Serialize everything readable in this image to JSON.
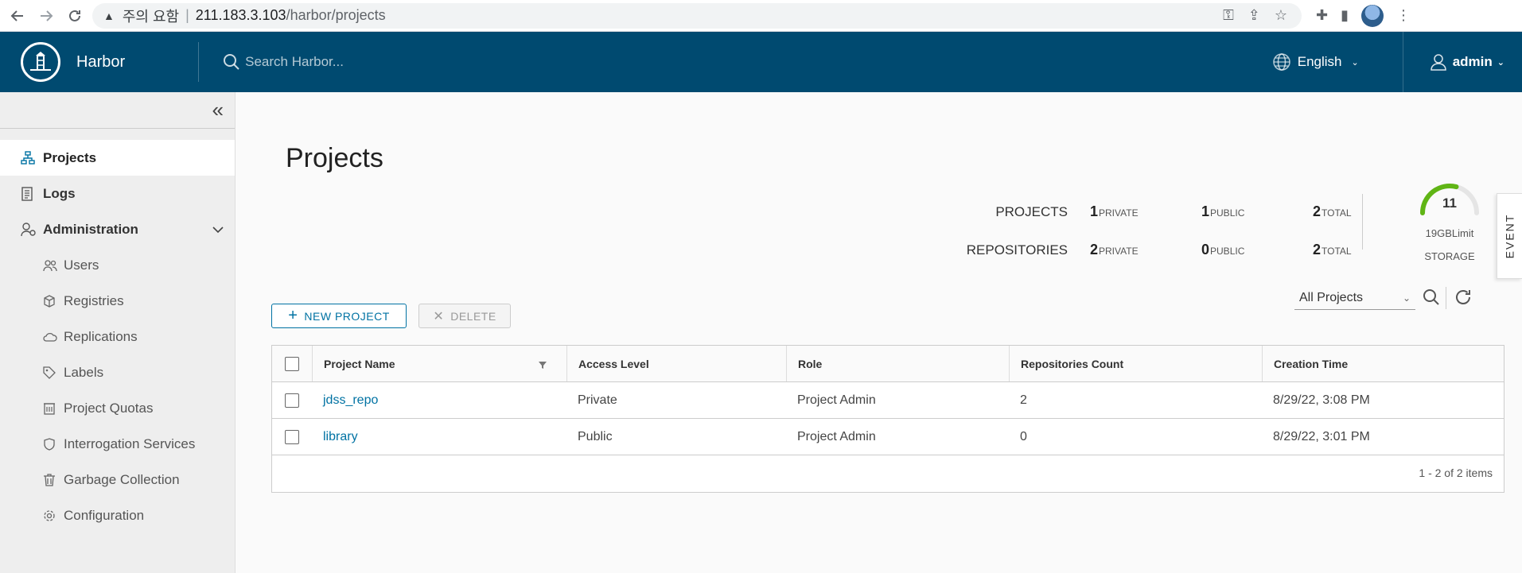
{
  "browser": {
    "warning_text": "주의 요함",
    "url_host": "211.183.3.103",
    "url_path": "/harbor/projects"
  },
  "header": {
    "brand": "Harbor",
    "search_placeholder": "Search Harbor...",
    "language": "English",
    "user": "admin",
    "bg_color": "#004a70"
  },
  "sidebar": {
    "items": [
      {
        "label": "Projects",
        "icon": "projects-icon",
        "active": true
      },
      {
        "label": "Logs",
        "icon": "logs-icon"
      },
      {
        "label": "Administration",
        "icon": "administration-icon",
        "expanded": true
      }
    ],
    "admin_items": [
      {
        "label": "Users",
        "icon": "users-icon"
      },
      {
        "label": "Registries",
        "icon": "registries-icon"
      },
      {
        "label": "Replications",
        "icon": "replications-icon"
      },
      {
        "label": "Labels",
        "icon": "labels-icon"
      },
      {
        "label": "Project Quotas",
        "icon": "project-quotas-icon"
      },
      {
        "label": "Interrogation Services",
        "icon": "interrogation-services-icon"
      },
      {
        "label": "Garbage Collection",
        "icon": "garbage-collection-icon"
      },
      {
        "label": "Configuration",
        "icon": "configuration-icon"
      }
    ]
  },
  "main": {
    "title": "Projects",
    "stats": {
      "projects_label": "PROJECTS",
      "repos_label": "REPOSITORIES",
      "projects_private": "1",
      "projects_public": "1",
      "projects_total": "2",
      "repos_private": "2",
      "repos_public": "0",
      "repos_total": "2",
      "private_word": "PRIVATE",
      "public_word": "PUBLIC",
      "total_word": "TOTAL"
    },
    "storage": {
      "used": "11",
      "limit": "19GBLimit",
      "label": "STORAGE",
      "used_fraction": 0.58
    },
    "event_tab": "EVENT",
    "buttons": {
      "new_project": "NEW PROJECT",
      "delete": "DELETE"
    },
    "filter": "All Projects",
    "table": {
      "headers": [
        "Project Name",
        "Access Level",
        "Role",
        "Repositories Count",
        "Creation Time"
      ],
      "rows": [
        {
          "name": "jdss_repo",
          "access": "Private",
          "role": "Project Admin",
          "count": "2",
          "created": "8/29/22, 3:08 PM"
        },
        {
          "name": "library",
          "access": "Public",
          "role": "Project Admin",
          "count": "0",
          "created": "8/29/22, 3:01 PM"
        }
      ],
      "footer": "1 - 2 of 2 items"
    }
  }
}
